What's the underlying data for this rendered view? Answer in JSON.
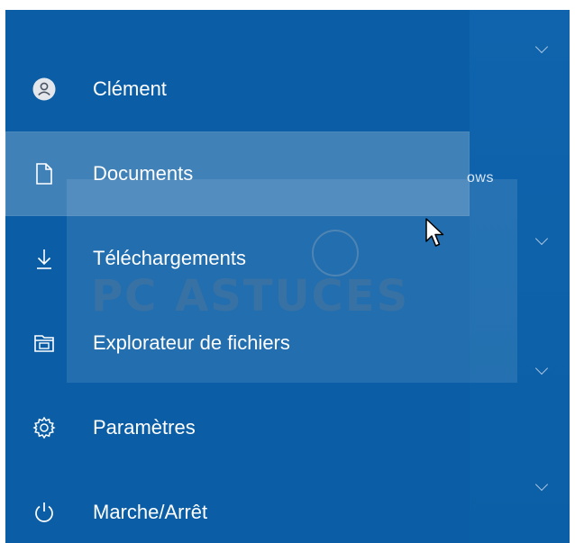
{
  "menu": {
    "items": [
      {
        "label": "Clément",
        "icon": "user-avatar-icon"
      },
      {
        "label": "Documents",
        "icon": "document-icon"
      },
      {
        "label": "Téléchargements",
        "icon": "download-icon"
      },
      {
        "label": "Explorateur de fichiers",
        "icon": "file-explorer-icon"
      },
      {
        "label": "Paramètres",
        "icon": "gear-icon"
      },
      {
        "label": "Marche/Arrêt",
        "icon": "power-icon"
      }
    ],
    "hovered_index": 1
  },
  "background": {
    "partial_text": "ows"
  },
  "watermark": {
    "text": "PC ASTUCES"
  },
  "colors": {
    "start_blue": "#0b5ea5",
    "hover_overlay": "rgba(255,255,255,0.22)",
    "text": "#ffffff"
  }
}
